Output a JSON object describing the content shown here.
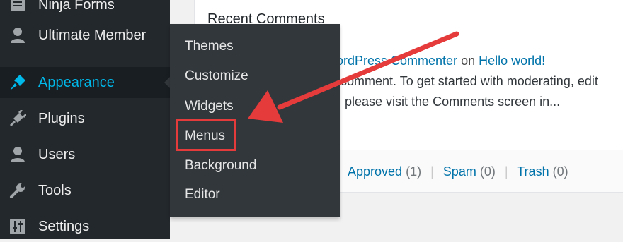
{
  "sidebar": {
    "items": [
      {
        "label": "Ninja Forms",
        "icon": "forms-icon"
      },
      {
        "label": "Ultimate Member",
        "icon": "user-icon"
      },
      {
        "label": "Appearance",
        "icon": "brush-icon"
      },
      {
        "label": "Plugins",
        "icon": "plugin-icon"
      },
      {
        "label": "Users",
        "icon": "users-icon"
      },
      {
        "label": "Tools",
        "icon": "wrench-icon"
      },
      {
        "label": "Settings",
        "icon": "settings-sliders-icon"
      }
    ],
    "active_item": "Appearance"
  },
  "flyout": {
    "items": [
      "Themes",
      "Customize",
      "Widgets",
      "Menus",
      "Background",
      "Editor"
    ],
    "highlighted": "Menus"
  },
  "panel": {
    "title": "Recent Comments",
    "comment": {
      "author": "ordPress Commenter",
      "on_text": "on",
      "post": "Hello world!",
      "excerpt_line1": "comment. To get started with moderating, edit",
      "excerpt_line2": "please visit the Comments screen in..."
    },
    "footer": {
      "approved_label": "Approved",
      "approved_count": "(1)",
      "spam_label": "Spam",
      "spam_count": "(0)",
      "trash_label": "Trash",
      "trash_count": "(0)",
      "separator": "|"
    }
  },
  "colors": {
    "sidebar_bg": "#23282d",
    "flyout_bg": "#32373c",
    "active_text": "#00b9eb",
    "link": "#0073aa",
    "annotation_red": "#e63b3b"
  }
}
